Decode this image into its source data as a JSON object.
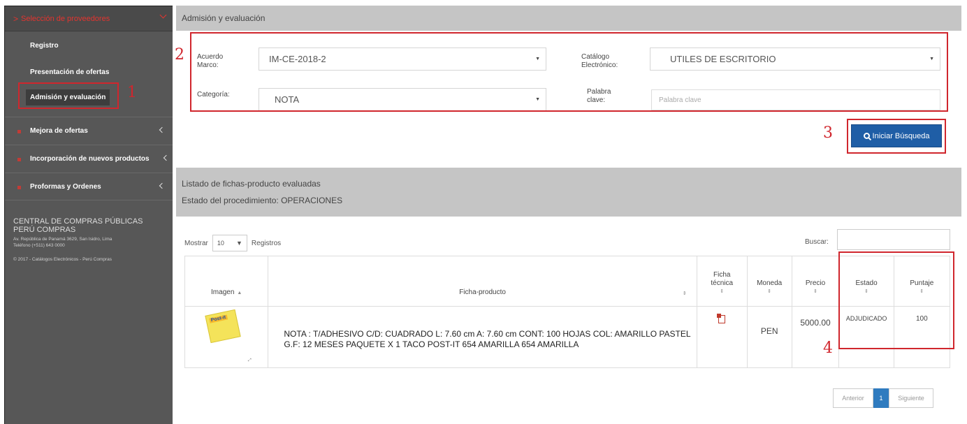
{
  "sidebar": {
    "header": "Selección de proveedores",
    "subitems": [
      {
        "label": "Registro"
      },
      {
        "label": "Presentación de ofertas"
      },
      {
        "label": "Admisión y evaluación"
      }
    ],
    "items": [
      {
        "label": "Mejora de ofertas"
      },
      {
        "label": "Incorporación de nuevos productos"
      },
      {
        "label": "Proformas y Ordenes"
      }
    ],
    "footer": {
      "org_line1": "CENTRAL DE COMPRAS PÚBLICAS",
      "org_line2": "PERÚ COMPRAS",
      "address": "Av. República de Panamá 3629, San Isidro, Lima",
      "phone": "Teléfono (+511) 643 0000",
      "copyright": "© 2017 - Catálogos Electrónicos - Perú Compras"
    }
  },
  "panel": {
    "title": "Admisión y evaluación"
  },
  "filters": {
    "acuerdo_label": "Acuerdo Marco:",
    "acuerdo_value": "IM-CE-2018-2",
    "catalogo_label": "Catálogo Electrónico:",
    "catalogo_value": "UTILES DE ESCRITORIO",
    "categoria_label": "Categoría:",
    "categoria_value": "NOTA",
    "palabra_label": "Palabra clave:",
    "palabra_placeholder": "Palabra clave"
  },
  "search_button": {
    "label": "Iniciar Búsqueda"
  },
  "listing": {
    "title": "Listado de fichas-producto evaluadas",
    "status": "Estado del procedimiento: OPERACIONES",
    "show_label": "Mostrar",
    "show_value": "10",
    "records_label": "Registros",
    "search_label": "Buscar:"
  },
  "table": {
    "headers": {
      "imagen": "Imagen",
      "ficha_producto": "Ficha-producto",
      "ficha_tecnica_1": "Ficha",
      "ficha_tecnica_2": "técnica",
      "moneda": "Moneda",
      "precio": "Precio",
      "estado": "Estado",
      "puntaje": "Puntaje"
    },
    "rows": [
      {
        "image_brand": "Post-it",
        "description": "NOTA : T/ADHESIVO C/D: CUADRADO L: 7.60 cm A: 7.60 cm CONT: 100 HOJAS COL: AMARILLO PASTEL G.F: 12 MESES PAQUETE X 1 TACO POST-IT 654 AMARILLA 654 AMARILLA",
        "moneda": "PEN",
        "precio": "5000.00",
        "estado": "ADJUDICADO",
        "puntaje": "100"
      }
    ]
  },
  "pagination": {
    "prev": "Anterior",
    "current": "1",
    "next": "Siguiente"
  },
  "annotations": {
    "n1": "1",
    "n2": "2",
    "n3": "3",
    "n4": "4",
    "color": "#d0262d"
  },
  "colors": {
    "sidebar_bg": "#575757",
    "panel_header_bg": "#c5c5c5",
    "primary_button": "#1f5ea6",
    "accent_red": "#e3342f"
  }
}
